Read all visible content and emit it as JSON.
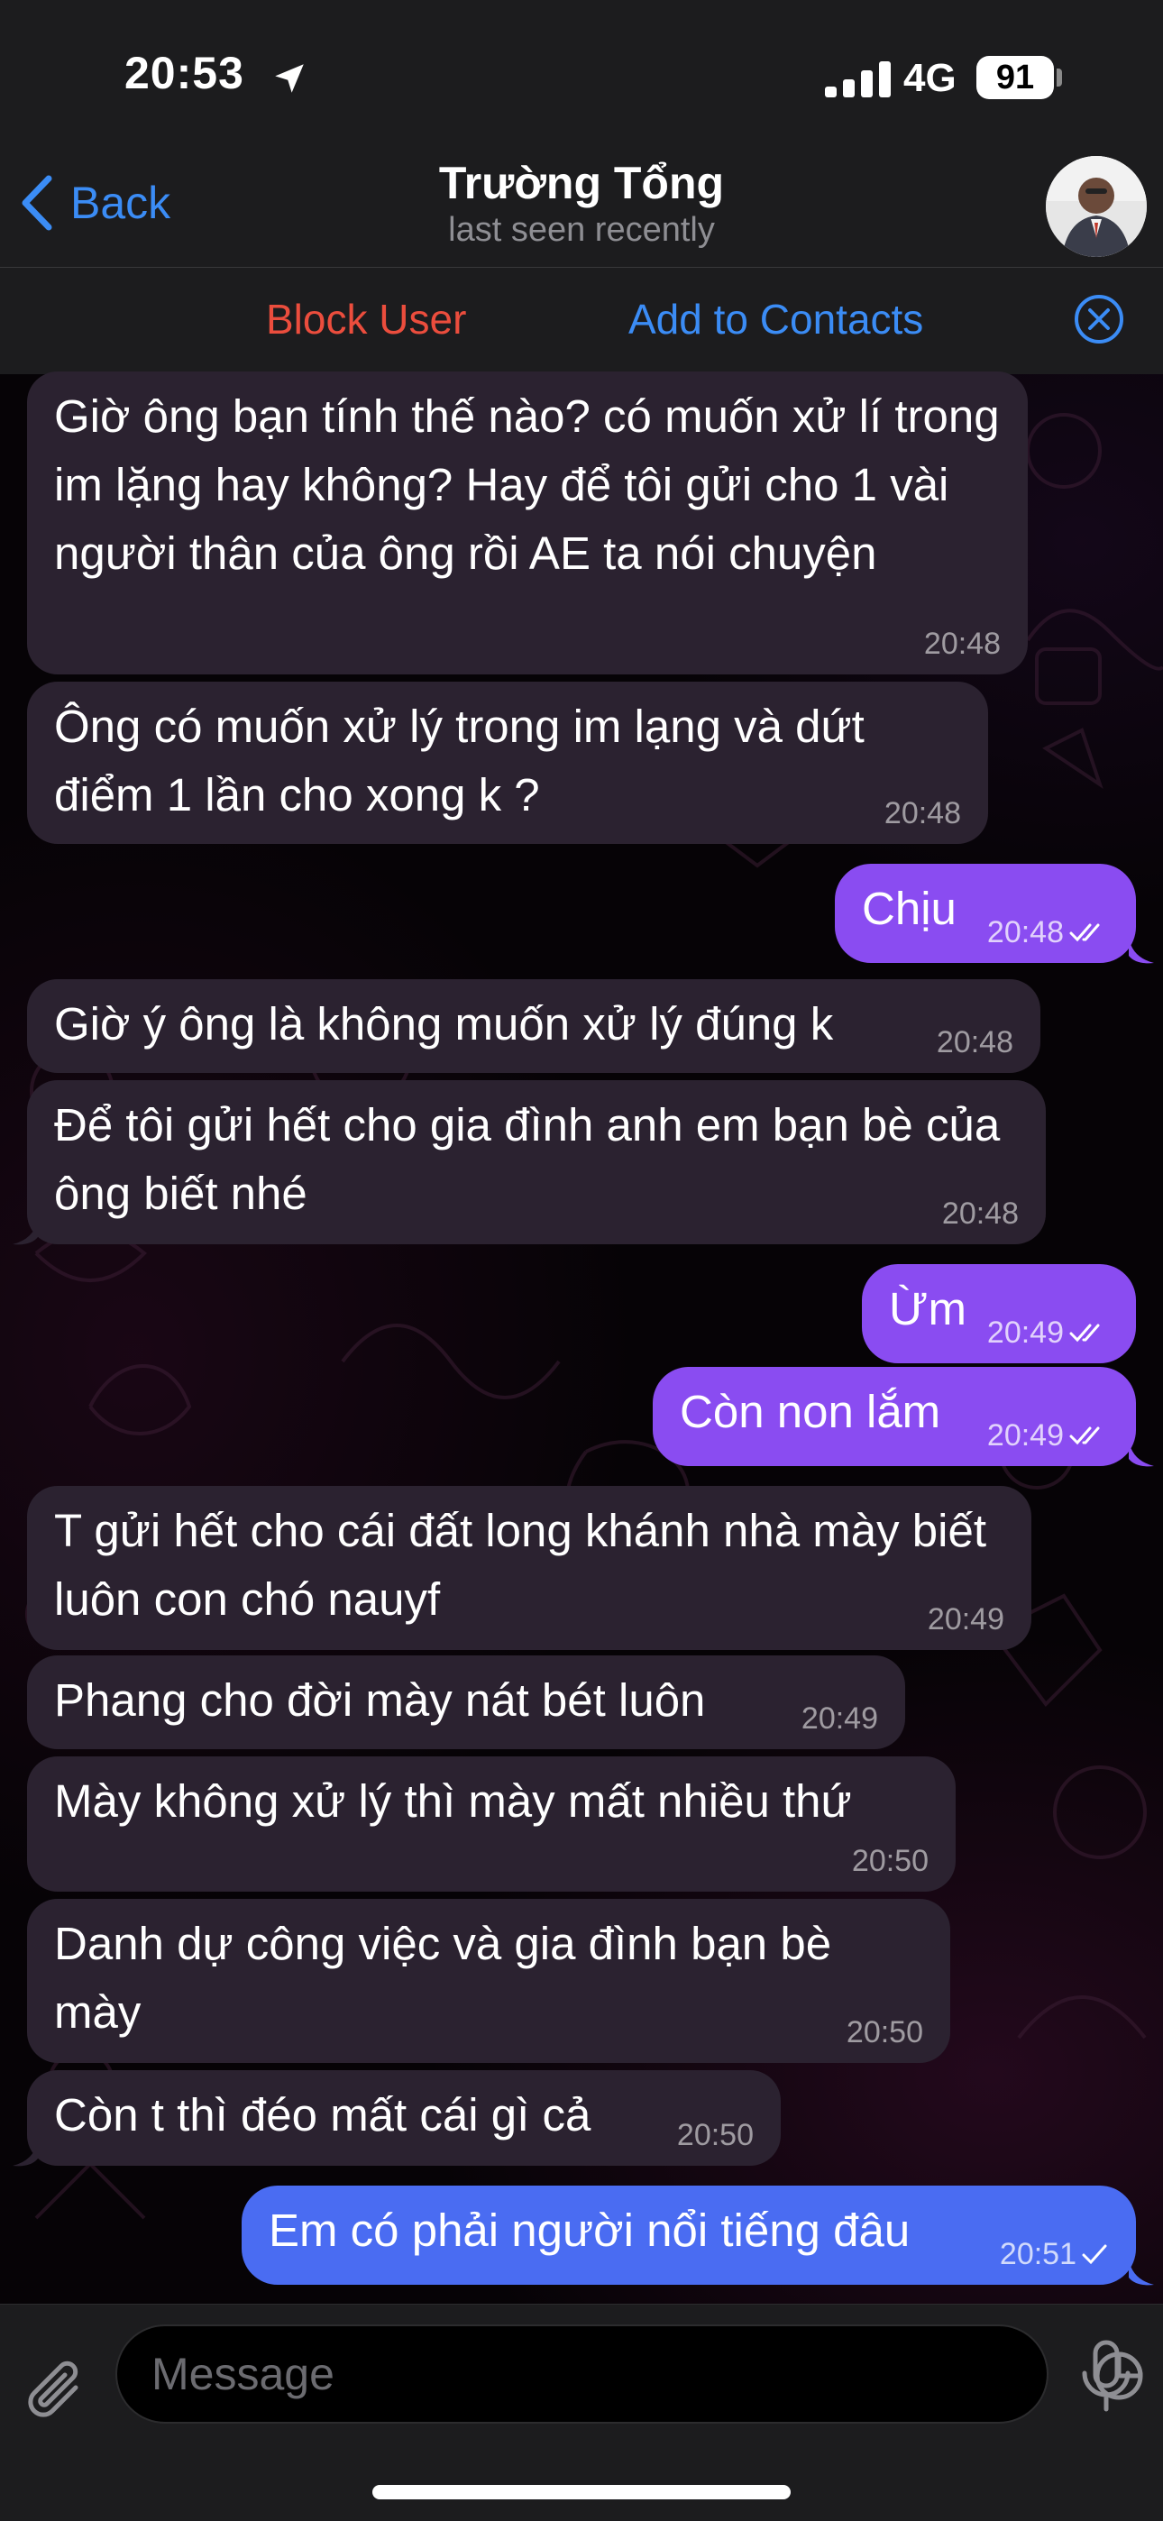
{
  "status": {
    "time": "20:53",
    "network": "4G",
    "battery": "91"
  },
  "header": {
    "back_label": "Back",
    "title": "Trường Tổng",
    "subtitle": "last seen recently",
    "block_label": "Block User",
    "add_contacts_label": "Add to Contacts"
  },
  "messages": [
    {
      "dir": "in",
      "text": "Giờ ông bạn tính thế nào? có muốn xử lí trong im lặng hay không? Hay để tôi gửi cho 1 vài người thân của ông rồi AE ta nói chuyện",
      "time": "20:48"
    },
    {
      "dir": "in",
      "text": "Ông có muốn xử lý trong im lạng và dứt điểm 1 lần cho xong k ?",
      "time": "20:48"
    },
    {
      "dir": "out",
      "text": "Chịu",
      "time": "20:48",
      "status": "read"
    },
    {
      "dir": "in",
      "text": "Giờ ý ông là không muốn xử lý đúng k",
      "time": "20:48"
    },
    {
      "dir": "in",
      "text": "Để tôi gửi hết cho gia đình anh em bạn bè của ông biết nhé",
      "time": "20:48"
    },
    {
      "dir": "out",
      "text": "Ừm",
      "time": "20:49",
      "status": "read"
    },
    {
      "dir": "out",
      "text": "Còn non lắm",
      "time": "20:49",
      "status": "read"
    },
    {
      "dir": "in",
      "text": "T gửi hết cho cái đất long khánh nhà mày biết luôn con chó nauyf",
      "time": "20:49"
    },
    {
      "dir": "in",
      "text": "Phang cho đời mày nát bét luôn",
      "time": "20:49"
    },
    {
      "dir": "in",
      "text": "Mày không xử lý thì mày mất nhiều thứ",
      "time": "20:50"
    },
    {
      "dir": "in",
      "text": "Danh dự công việc và gia đình bạn bè mày",
      "time": "20:50"
    },
    {
      "dir": "in",
      "text": "Còn t thì đéo mất cái gì cả",
      "time": "20:50"
    },
    {
      "dir": "out",
      "text": "Em có phải người nổi tiếng đâu",
      "time": "20:51",
      "status": "sent"
    }
  ],
  "composer": {
    "placeholder": "Message"
  },
  "colors": {
    "accent": "#3b8cf5",
    "danger": "#eb4d3d",
    "outgoing_bubble": "#8a4cf1",
    "incoming_bubble": "#2b2230"
  },
  "icons": [
    "location-arrow-icon",
    "signal-icon",
    "battery-icon",
    "back-chevron-icon",
    "close-circle-icon",
    "double-check-icon",
    "single-check-icon",
    "paperclip-icon",
    "sticker-icon",
    "microphone-icon"
  ]
}
